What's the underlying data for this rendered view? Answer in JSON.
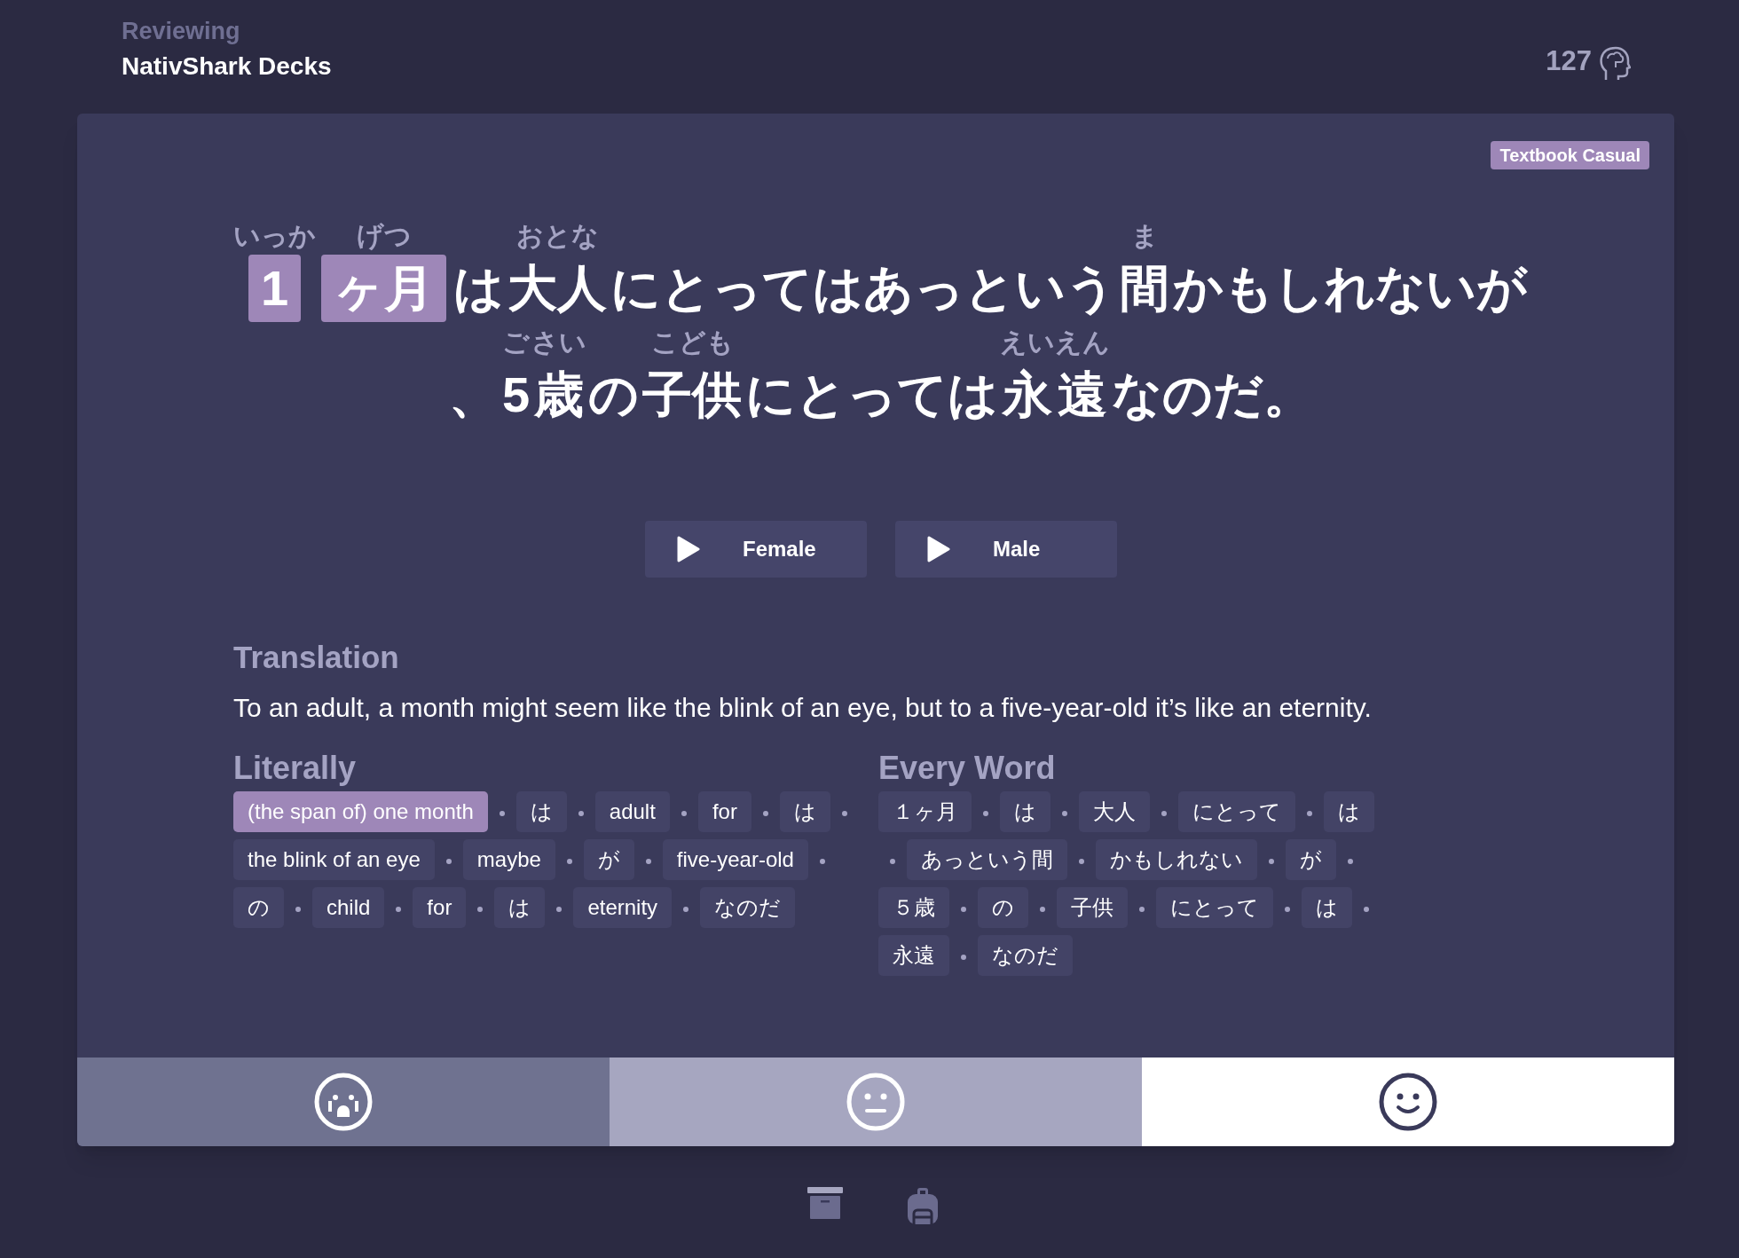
{
  "header": {
    "subtitle": "Reviewing",
    "title": "NativShark Decks",
    "count": "127"
  },
  "card": {
    "tag": "Textbook Casual",
    "sentence_lines": [
      [
        {
          "text": "1",
          "reading": "いっか",
          "highlighted": true
        },
        {
          "text": "ヶ月",
          "reading": "げつ",
          "highlighted": true
        },
        {
          "text": "は",
          "highlighted": false
        },
        {
          "text": "大人",
          "reading": "おとな",
          "highlighted": false
        },
        {
          "text": "にとってはあっという",
          "highlighted": false
        },
        {
          "text": "間",
          "reading": "ま",
          "highlighted": false
        },
        {
          "text": "かもしれないが",
          "highlighted": false
        }
      ],
      [
        {
          "text": "、",
          "highlighted": false
        },
        {
          "text": "5",
          "reading": "ご",
          "highlighted": false
        },
        {
          "text": "歳",
          "reading": "さい",
          "highlighted": false
        },
        {
          "text": "の",
          "highlighted": false
        },
        {
          "text": "子供",
          "reading": "こども",
          "highlighted": false
        },
        {
          "text": "にとっては",
          "highlighted": false
        },
        {
          "text": "永",
          "reading": "えい",
          "highlighted": false
        },
        {
          "text": "遠",
          "reading": "えん",
          "highlighted": false
        },
        {
          "text": "なのだ。",
          "highlighted": false
        }
      ]
    ],
    "audio_buttons": [
      "Female",
      "Male"
    ],
    "translation": {
      "heading": "Translation",
      "text": "To an adult, a month might seem like the blink of an eye, but to a five-year-old it’s like an eternity."
    },
    "literally": {
      "heading": "Literally",
      "words": [
        {
          "text": "(the span of) one month",
          "highlighted": true
        },
        {
          "text": "は",
          "highlighted": false
        },
        {
          "text": "adult",
          "highlighted": false
        },
        {
          "text": "for",
          "highlighted": false
        },
        {
          "text": "は",
          "highlighted": false
        },
        {
          "text": "the blink of an eye",
          "highlighted": false
        },
        {
          "text": "maybe",
          "highlighted": false
        },
        {
          "text": "が",
          "highlighted": false
        },
        {
          "text": "five-year-old",
          "highlighted": false
        },
        {
          "text": "の",
          "highlighted": false
        },
        {
          "text": "child",
          "highlighted": false
        },
        {
          "text": "for",
          "highlighted": false
        },
        {
          "text": "は",
          "highlighted": false
        },
        {
          "text": "eternity",
          "highlighted": false
        },
        {
          "text": "なのだ",
          "highlighted": false
        }
      ]
    },
    "every_word": {
      "heading": "Every Word",
      "words": [
        "１ヶ月",
        "は",
        "大人",
        "にとって",
        "は",
        "あっという間",
        "かもしれない",
        "が",
        "５歳",
        "の",
        "子供",
        "にとって",
        "は",
        "永遠",
        "なのだ"
      ]
    }
  },
  "feedback_buttons": [
    {
      "kind": "sad",
      "selected": false
    },
    {
      "kind": "neutral",
      "selected": false
    },
    {
      "kind": "happy",
      "selected": true
    }
  ]
}
